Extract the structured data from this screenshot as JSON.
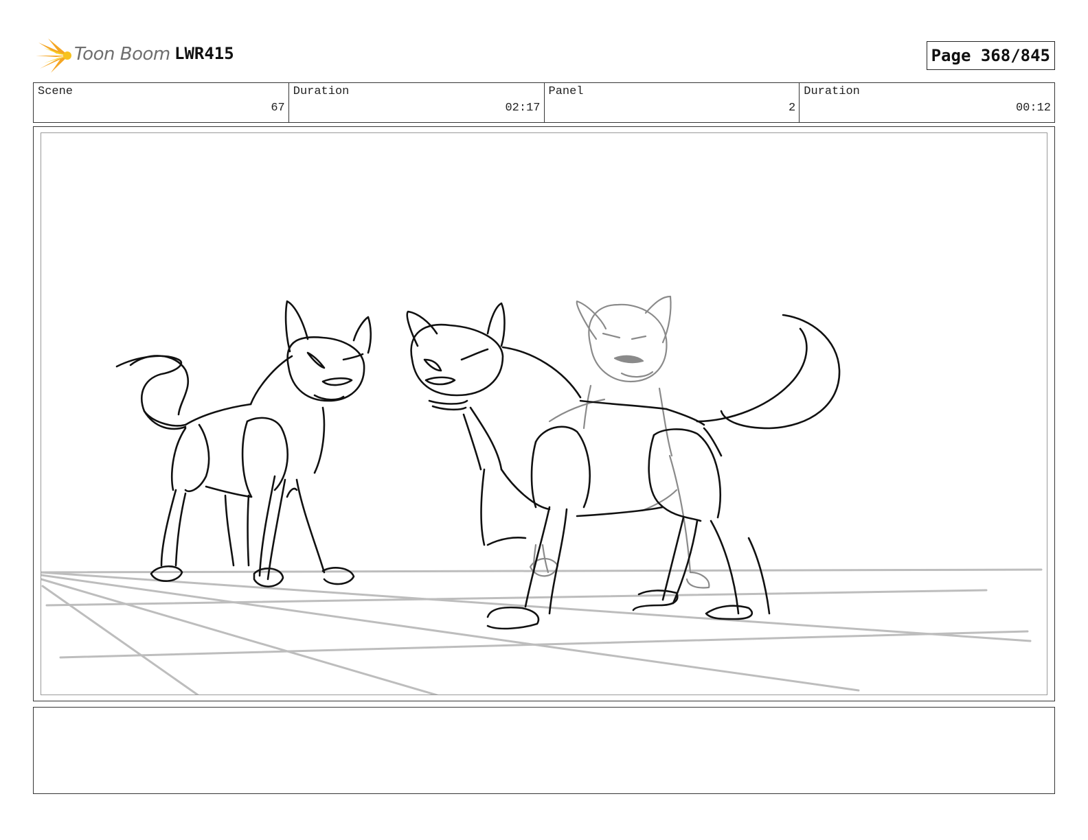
{
  "header": {
    "logo_text": "Toon Boom",
    "project_code": "LWR415",
    "page_label": "Page 368/845"
  },
  "info": {
    "scene_label": "Scene",
    "scene_value": "67",
    "scene_duration_label": "Duration",
    "scene_duration_value": "02:17",
    "panel_label": "Panel",
    "panel_value": "2",
    "panel_duration_label": "Duration",
    "panel_duration_value": "00:12"
  },
  "colors": {
    "logo_orange": "#f5a623",
    "logo_yellow": "#f7d31e",
    "sketch_dark": "#111111",
    "sketch_light": "#8a8a8a",
    "floor_lines": "#bdbdbd"
  },
  "icons": {
    "logo": "toon-boom-sunburst-icon"
  }
}
